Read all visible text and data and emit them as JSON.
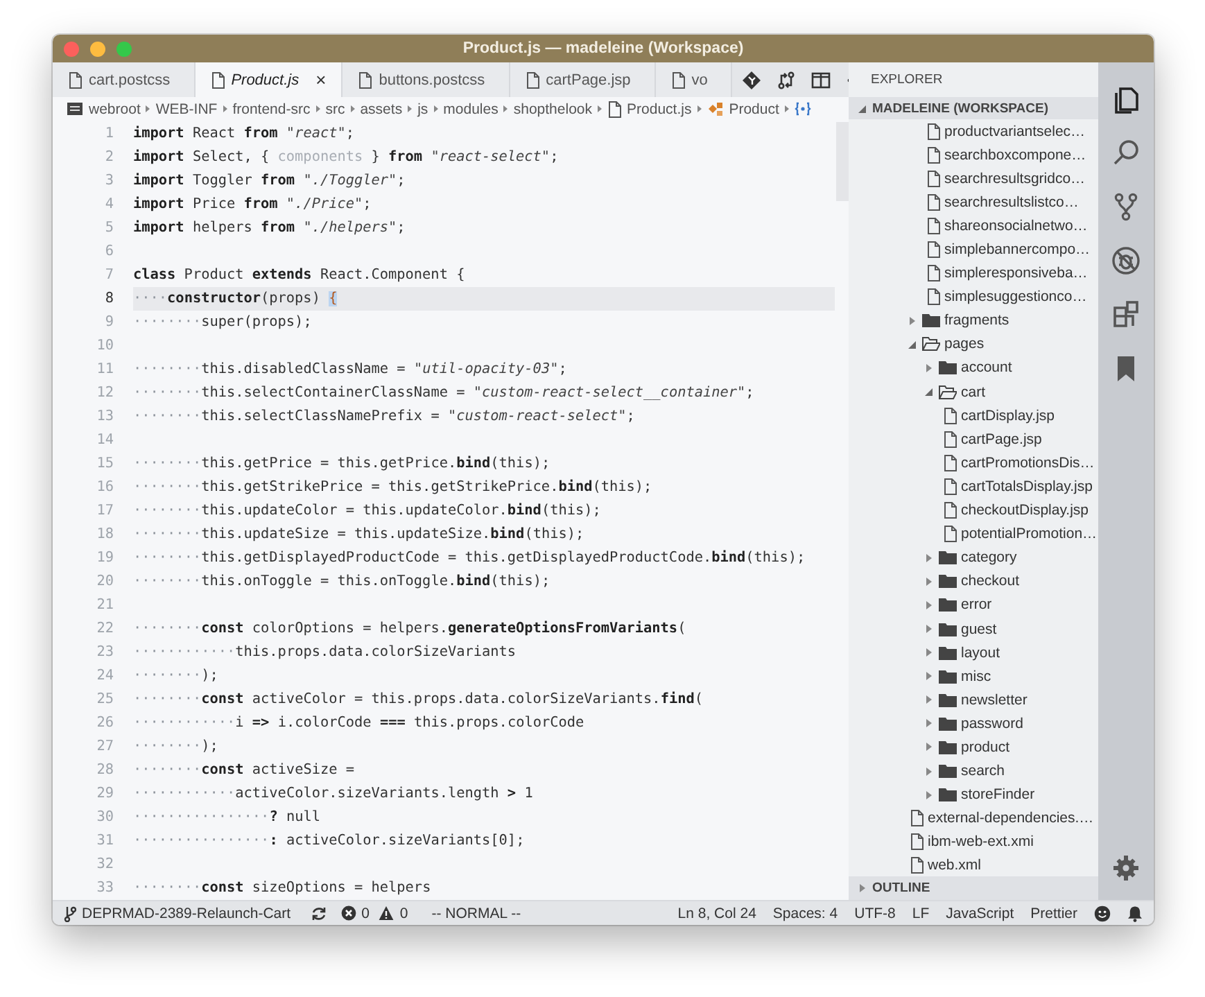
{
  "window": {
    "title": "Product.js — madeleine (Workspace)"
  },
  "tabs": [
    {
      "label": "cart.postcss",
      "selected": false,
      "preview": false
    },
    {
      "label": "Product.js",
      "selected": true,
      "preview": true,
      "close": "×"
    },
    {
      "label": "buttons.postcss",
      "selected": false,
      "preview": false
    },
    {
      "label": "cartPage.jsp",
      "selected": false,
      "preview": false
    },
    {
      "label": "vo",
      "selected": false,
      "preview": false
    }
  ],
  "breadcrumbs": [
    {
      "kind": "root",
      "label": "webroot"
    },
    {
      "kind": "folder",
      "label": "WEB-INF"
    },
    {
      "kind": "folder",
      "label": "frontend-src"
    },
    {
      "kind": "folder",
      "label": "src"
    },
    {
      "kind": "folder",
      "label": "assets"
    },
    {
      "kind": "folder",
      "label": "js"
    },
    {
      "kind": "folder",
      "label": "modules"
    },
    {
      "kind": "folder",
      "label": "shopthelook"
    },
    {
      "kind": "file",
      "label": "Product.js"
    },
    {
      "kind": "class",
      "label": "Product"
    },
    {
      "kind": "member"
    }
  ],
  "code": {
    "lines": [
      {
        "number": "1",
        "current": false,
        "tokens": [
          {
            "kind": "kw",
            "text": "import"
          },
          {
            "kind": "plain",
            "text": " React "
          },
          {
            "kind": "kw",
            "text": "from "
          },
          {
            "kind": "str",
            "text": "\"react\""
          },
          {
            "kind": "plain",
            "text": ";"
          }
        ]
      },
      {
        "number": "2",
        "current": false,
        "tokens": [
          {
            "kind": "kw",
            "text": "import"
          },
          {
            "kind": "plain",
            "text": " Select, { "
          },
          {
            "kind": "dim",
            "text": "components"
          },
          {
            "kind": "plain",
            "text": " } "
          },
          {
            "kind": "kw",
            "text": "from "
          },
          {
            "kind": "str",
            "text": "\"react-select\""
          },
          {
            "kind": "plain",
            "text": ";"
          }
        ]
      },
      {
        "number": "3",
        "current": false,
        "tokens": [
          {
            "kind": "kw",
            "text": "import"
          },
          {
            "kind": "plain",
            "text": " Toggler "
          },
          {
            "kind": "kw",
            "text": "from "
          },
          {
            "kind": "str",
            "text": "\"./Toggler\""
          },
          {
            "kind": "plain",
            "text": ";"
          }
        ]
      },
      {
        "number": "4",
        "current": false,
        "tokens": [
          {
            "kind": "kw",
            "text": "import"
          },
          {
            "kind": "plain",
            "text": " Price "
          },
          {
            "kind": "kw",
            "text": "from "
          },
          {
            "kind": "str",
            "text": "\"./Price\""
          },
          {
            "kind": "plain",
            "text": ";"
          }
        ]
      },
      {
        "number": "5",
        "current": false,
        "tokens": [
          {
            "kind": "kw",
            "text": "import"
          },
          {
            "kind": "plain",
            "text": " helpers "
          },
          {
            "kind": "kw",
            "text": "from "
          },
          {
            "kind": "str",
            "text": "\"./helpers\""
          },
          {
            "kind": "plain",
            "text": ";"
          }
        ]
      },
      {
        "number": "6",
        "current": false
      },
      {
        "number": "7",
        "current": false,
        "tokens": [
          {
            "kind": "kw",
            "text": "class"
          },
          {
            "kind": "plain",
            "text": " Product "
          },
          {
            "kind": "kw",
            "text": "extends"
          },
          {
            "kind": "plain",
            "text": " React.Component {"
          }
        ]
      },
      {
        "number": "8",
        "current": true,
        "tokens": [
          {
            "kind": "ws",
            "text": "····"
          },
          {
            "kind": "kw",
            "text": "constructor"
          },
          {
            "kind": "plain",
            "text": "(props) "
          },
          {
            "kind": "brace",
            "text": "{"
          }
        ]
      },
      {
        "number": "9",
        "current": false,
        "tokens": [
          {
            "kind": "ws",
            "text": "········"
          },
          {
            "kind": "plain",
            "text": "super(props);"
          }
        ]
      },
      {
        "number": "10",
        "current": false
      },
      {
        "number": "11",
        "current": false,
        "tokens": [
          {
            "kind": "ws",
            "text": "········"
          },
          {
            "kind": "plain",
            "text": "this.disabledClassName = "
          },
          {
            "kind": "str",
            "text": "\"util-opacity-03\""
          },
          {
            "kind": "plain",
            "text": ";"
          }
        ]
      },
      {
        "number": "12",
        "current": false,
        "tokens": [
          {
            "kind": "ws",
            "text": "········"
          },
          {
            "kind": "plain",
            "text": "this.selectContainerClassName = "
          },
          {
            "kind": "str",
            "text": "\"custom-react-select__container\""
          },
          {
            "kind": "plain",
            "text": ";"
          }
        ]
      },
      {
        "number": "13",
        "current": false,
        "tokens": [
          {
            "kind": "ws",
            "text": "········"
          },
          {
            "kind": "plain",
            "text": "this.selectClassNamePrefix = "
          },
          {
            "kind": "str",
            "text": "\"custom-react-select\""
          },
          {
            "kind": "plain",
            "text": ";"
          }
        ]
      },
      {
        "number": "14",
        "current": false
      },
      {
        "number": "15",
        "current": false,
        "tokens": [
          {
            "kind": "ws",
            "text": "········"
          },
          {
            "kind": "plain",
            "text": "this.getPrice = this.getPrice."
          },
          {
            "kind": "kw",
            "text": "bind"
          },
          {
            "kind": "plain",
            "text": "(this);"
          }
        ]
      },
      {
        "number": "16",
        "current": false,
        "tokens": [
          {
            "kind": "ws",
            "text": "········"
          },
          {
            "kind": "plain",
            "text": "this.getStrikePrice = this.getStrikePrice."
          },
          {
            "kind": "kw",
            "text": "bind"
          },
          {
            "kind": "plain",
            "text": "(this);"
          }
        ]
      },
      {
        "number": "17",
        "current": false,
        "tokens": [
          {
            "kind": "ws",
            "text": "········"
          },
          {
            "kind": "plain",
            "text": "this.updateColor = this.updateColor."
          },
          {
            "kind": "kw",
            "text": "bind"
          },
          {
            "kind": "plain",
            "text": "(this);"
          }
        ]
      },
      {
        "number": "18",
        "current": false,
        "tokens": [
          {
            "kind": "ws",
            "text": "········"
          },
          {
            "kind": "plain",
            "text": "this.updateSize = this.updateSize."
          },
          {
            "kind": "kw",
            "text": "bind"
          },
          {
            "kind": "plain",
            "text": "(this);"
          }
        ]
      },
      {
        "number": "19",
        "current": false,
        "tokens": [
          {
            "kind": "ws",
            "text": "········"
          },
          {
            "kind": "plain",
            "text": "this.getDisplayedProductCode = this.getDisplayedProductCode."
          },
          {
            "kind": "kw",
            "text": "bind"
          },
          {
            "kind": "plain",
            "text": "(this);"
          }
        ]
      },
      {
        "number": "20",
        "current": false,
        "tokens": [
          {
            "kind": "ws",
            "text": "········"
          },
          {
            "kind": "plain",
            "text": "this.onToggle = this.onToggle."
          },
          {
            "kind": "kw",
            "text": "bind"
          },
          {
            "kind": "plain",
            "text": "(this);"
          }
        ]
      },
      {
        "number": "21",
        "current": false
      },
      {
        "number": "22",
        "current": false,
        "tokens": [
          {
            "kind": "ws",
            "text": "········"
          },
          {
            "kind": "kw",
            "text": "const"
          },
          {
            "kind": "plain",
            "text": " colorOptions = helpers."
          },
          {
            "kind": "kw",
            "text": "generateOptionsFromVariants"
          },
          {
            "kind": "plain",
            "text": "("
          }
        ]
      },
      {
        "number": "23",
        "current": false,
        "tokens": [
          {
            "kind": "ws",
            "text": "············"
          },
          {
            "kind": "plain",
            "text": "this.props.data.colorSizeVariants"
          }
        ]
      },
      {
        "number": "24",
        "current": false,
        "tokens": [
          {
            "kind": "ws",
            "text": "········"
          },
          {
            "kind": "plain",
            "text": ");"
          }
        ]
      },
      {
        "number": "25",
        "current": false,
        "tokens": [
          {
            "kind": "ws",
            "text": "········"
          },
          {
            "kind": "kw",
            "text": "const"
          },
          {
            "kind": "plain",
            "text": " activeColor = this.props.data.colorSizeVariants."
          },
          {
            "kind": "kw",
            "text": "find"
          },
          {
            "kind": "plain",
            "text": "("
          }
        ]
      },
      {
        "number": "26",
        "current": false,
        "tokens": [
          {
            "kind": "ws",
            "text": "············"
          },
          {
            "kind": "plain",
            "text": "i "
          },
          {
            "kind": "kw",
            "text": "=>"
          },
          {
            "kind": "plain",
            "text": " i.colorCode "
          },
          {
            "kind": "kw",
            "text": "==="
          },
          {
            "kind": "plain",
            "text": " this.props.colorCode"
          }
        ]
      },
      {
        "number": "27",
        "current": false,
        "tokens": [
          {
            "kind": "ws",
            "text": "········"
          },
          {
            "kind": "plain",
            "text": ");"
          }
        ]
      },
      {
        "number": "28",
        "current": false,
        "tokens": [
          {
            "kind": "ws",
            "text": "········"
          },
          {
            "kind": "kw",
            "text": "const"
          },
          {
            "kind": "plain",
            "text": " activeSize ="
          }
        ]
      },
      {
        "number": "29",
        "current": false,
        "tokens": [
          {
            "kind": "ws",
            "text": "············"
          },
          {
            "kind": "plain",
            "text": "activeColor.sizeVariants.length "
          },
          {
            "kind": "kw",
            "text": ">"
          },
          {
            "kind": "plain",
            "text": " 1"
          }
        ]
      },
      {
        "number": "30",
        "current": false,
        "tokens": [
          {
            "kind": "ws",
            "text": "················"
          },
          {
            "kind": "kw",
            "text": "?"
          },
          {
            "kind": "plain",
            "text": " null"
          }
        ]
      },
      {
        "number": "31",
        "current": false,
        "tokens": [
          {
            "kind": "ws",
            "text": "················"
          },
          {
            "kind": "kw",
            "text": ":"
          },
          {
            "kind": "plain",
            "text": " activeColor.sizeVariants[0];"
          }
        ]
      },
      {
        "number": "32",
        "current": false
      },
      {
        "number": "33",
        "current": false,
        "tokens": [
          {
            "kind": "ws",
            "text": "········"
          },
          {
            "kind": "kw",
            "text": "const"
          },
          {
            "kind": "plain",
            "text": " sizeOptions = helpers"
          }
        ]
      }
    ]
  },
  "explorer": {
    "title": "EXPLORER",
    "workspace": {
      "label": "MADELEINE (WORKSPACE)",
      "expanded": true
    },
    "tree": [
      {
        "kind": "folder",
        "children": [
          {
            "kind": "file",
            "label": "productvariantselec…"
          },
          {
            "kind": "file",
            "label": "searchboxcompone…"
          },
          {
            "kind": "file",
            "label": "searchresultsgridco…"
          },
          {
            "kind": "file",
            "label": "searchresultslistco…"
          },
          {
            "kind": "file",
            "label": "shareonsocialnetwo…"
          },
          {
            "kind": "file",
            "label": "simplebannercompo…"
          },
          {
            "kind": "file",
            "label": "simpleresponsiveba…"
          },
          {
            "kind": "file",
            "label": "simplesuggestionco…"
          }
        ]
      },
      {
        "kind": "folder",
        "label": "fragments",
        "expanded": false
      },
      {
        "kind": "folder",
        "label": "pages",
        "expanded": true,
        "children": [
          {
            "kind": "folder",
            "label": "account",
            "expanded": false
          },
          {
            "kind": "folder",
            "label": "cart",
            "expanded": true,
            "children": [
              {
                "kind": "file",
                "label": "cartDisplay.jsp"
              },
              {
                "kind": "file",
                "label": "cartPage.jsp"
              },
              {
                "kind": "file",
                "label": "cartPromotionsDis…"
              },
              {
                "kind": "file",
                "label": "cartTotalsDisplay.jsp"
              },
              {
                "kind": "file",
                "label": "checkoutDisplay.jsp"
              },
              {
                "kind": "file",
                "label": "potentialPromotion…"
              }
            ]
          },
          {
            "kind": "folder",
            "label": "category",
            "expanded": false
          },
          {
            "kind": "folder",
            "label": "checkout",
            "expanded": false
          },
          {
            "kind": "folder",
            "label": "error",
            "expanded": false
          },
          {
            "kind": "folder",
            "label": "guest",
            "expanded": false
          },
          {
            "kind": "folder",
            "label": "layout",
            "expanded": false
          },
          {
            "kind": "folder",
            "label": "misc",
            "expanded": false
          },
          {
            "kind": "folder",
            "label": "newsletter",
            "expanded": false
          },
          {
            "kind": "folder",
            "label": "password",
            "expanded": false
          },
          {
            "kind": "folder",
            "label": "product",
            "expanded": false
          },
          {
            "kind": "folder",
            "label": "search",
            "expanded": false
          },
          {
            "kind": "folder",
            "label": "storeFinder",
            "expanded": false
          }
        ]
      },
      {
        "kind": "file",
        "label": "external-dependencies.…"
      },
      {
        "kind": "file",
        "label": "ibm-web-ext.xmi"
      },
      {
        "kind": "file",
        "label": "web.xml"
      }
    ],
    "outline": {
      "label": "OUTLINE",
      "expanded": false
    }
  },
  "activity_bar": [
    {
      "kind": "files",
      "selected": true
    },
    {
      "kind": "search",
      "selected": false
    },
    {
      "kind": "scm",
      "selected": false
    },
    {
      "kind": "debug",
      "selected": false
    },
    {
      "kind": "extensions",
      "selected": false
    },
    {
      "kind": "bookmarks",
      "selected": false
    }
  ],
  "status_bar": {
    "branch": "DEPRMAD-2389-Relaunch-Cart",
    "errors": "0",
    "warnings": "0",
    "mode": "-- NORMAL --",
    "right": [
      "Ln 8, Col 24",
      "Spaces: 4",
      "UTF-8",
      "LF",
      "JavaScript",
      "Prettier"
    ]
  }
}
